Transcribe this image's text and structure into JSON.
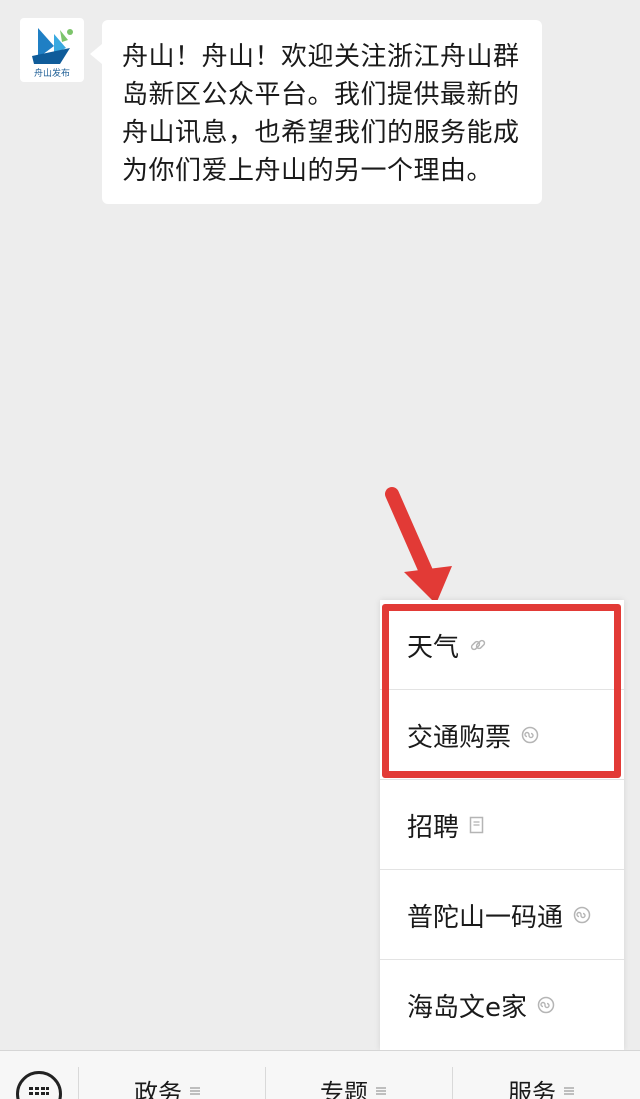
{
  "account": {
    "avatar_text": "舟山发布",
    "avatar_icon": "zhoushan-sail-logo"
  },
  "message": {
    "text": "舟山！舟山！欢迎关注浙江舟山群岛新区公众平台。我们提供最新的舟山讯息，也希望我们的服务能成为你们爱上舟山的另一个理由。"
  },
  "menu": {
    "items": [
      {
        "label": "天气",
        "icon": "link-icon"
      },
      {
        "label": "交通购票",
        "icon": "mini-program-icon"
      },
      {
        "label": "招聘",
        "icon": "article-icon"
      },
      {
        "label": "普陀山一码通",
        "icon": "mini-program-icon"
      },
      {
        "label": "海岛文e家",
        "icon": "mini-program-icon"
      }
    ]
  },
  "bottom_bar": {
    "tabs": [
      {
        "label": "政务"
      },
      {
        "label": "专题"
      },
      {
        "label": "服务"
      }
    ]
  },
  "colors": {
    "background": "#ededed",
    "highlight": "#e23a36",
    "logo_blue": "#1f7fc4"
  }
}
